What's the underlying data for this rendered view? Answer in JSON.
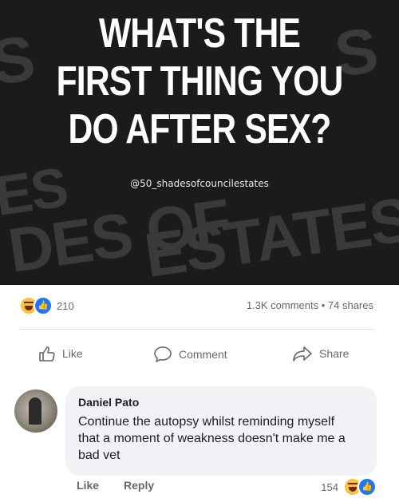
{
  "post": {
    "headline_lines": [
      "WHAT'S THE",
      "FIRST THING YOU",
      "DO AFTER SEX?"
    ],
    "handle": "@50_shadesofcouncilestates"
  },
  "stats": {
    "reaction_count": "210",
    "comments_shares": "1.3K comments • 74 shares"
  },
  "actions": {
    "like": "Like",
    "comment": "Comment",
    "share": "Share"
  },
  "comment": {
    "author": "Daniel Pato",
    "text": "Continue the autopsy whilst reminding myself that a moment of weakness doesn't make me a bad vet",
    "like": "Like",
    "reply": "Reply",
    "reaction_count": "154"
  },
  "colors": {
    "facebook_blue": "#1f78f2",
    "muted_text": "#65676b",
    "bubble_bg": "#f0f2f5"
  }
}
